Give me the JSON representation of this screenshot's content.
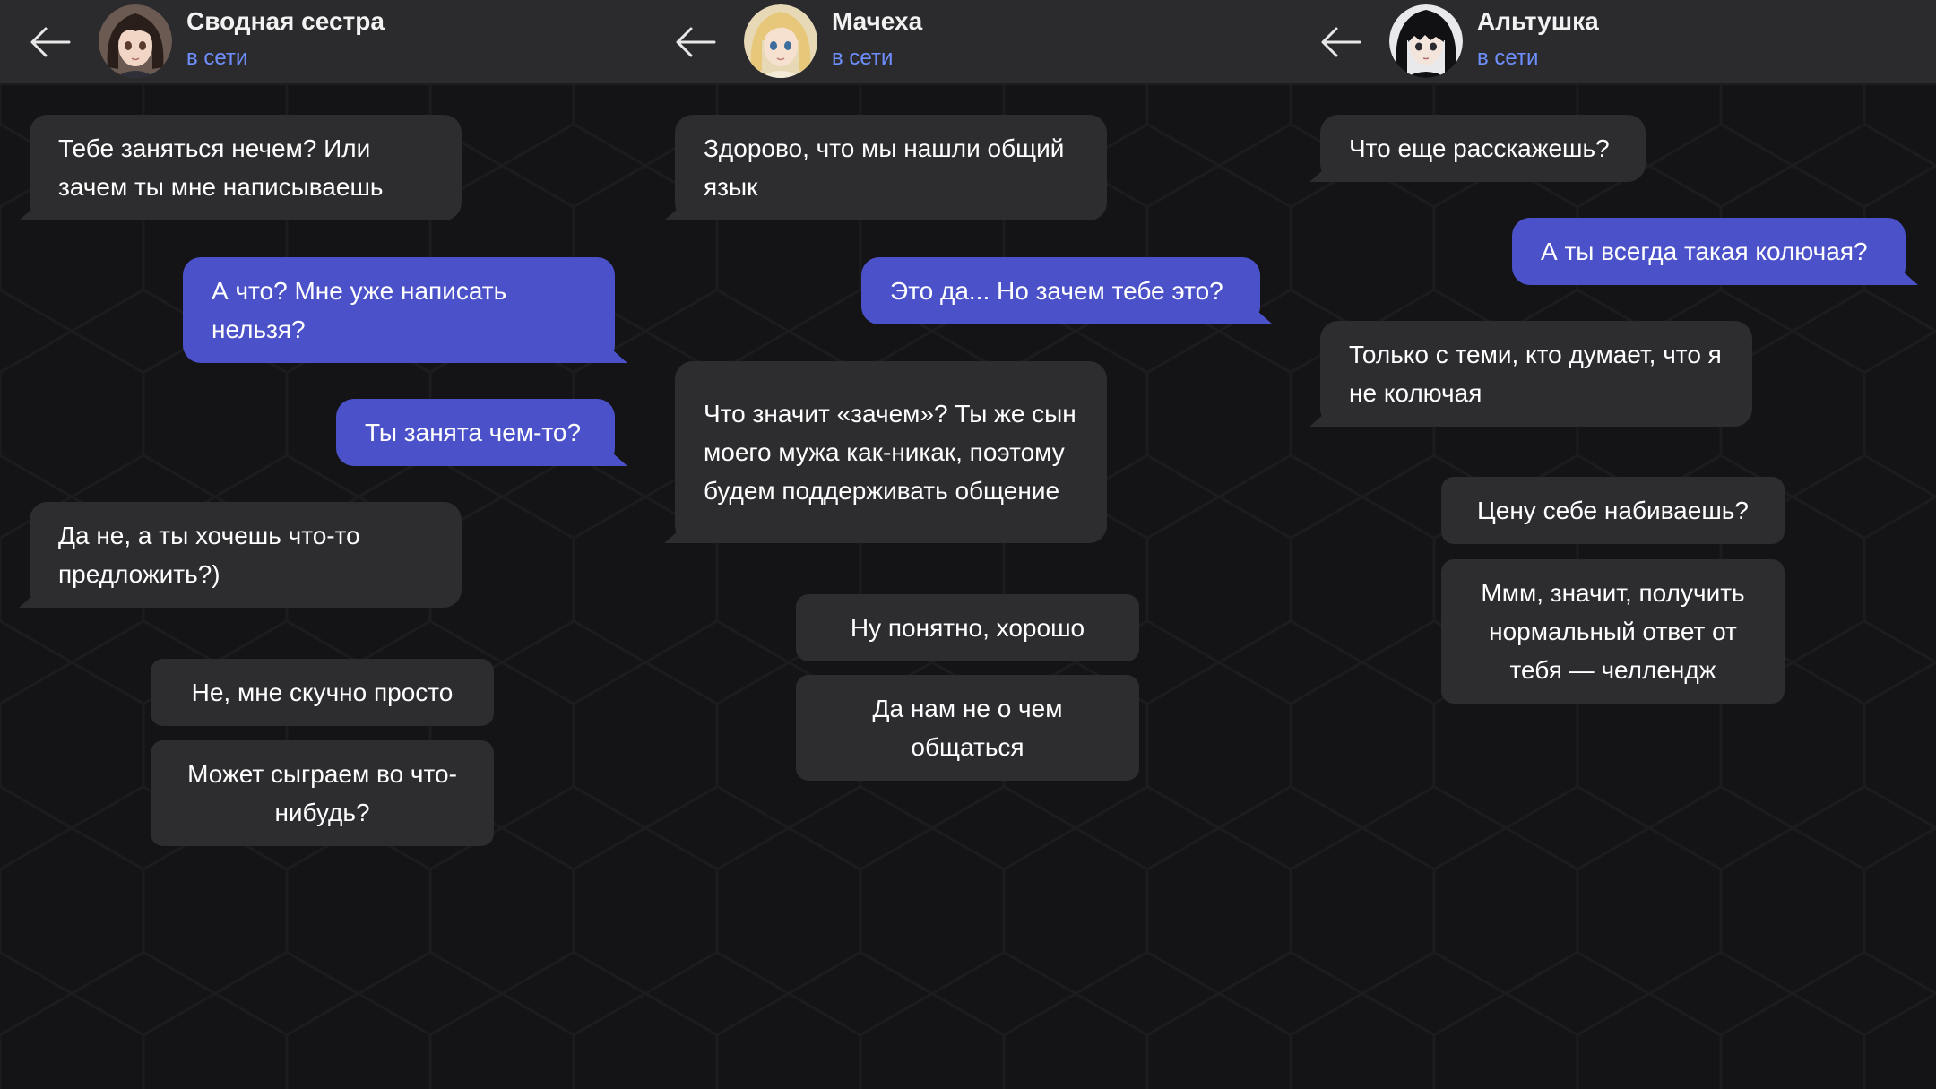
{
  "chats": [
    {
      "contact": {
        "name": "Сводная сестра",
        "status": "в сети",
        "avatar": "anime-girl-dark-hair-avatar"
      },
      "messages": [
        {
          "from": "contact",
          "text": "Тебе заняться нечем? Или зачем ты мне написываешь"
        },
        {
          "from": "user",
          "text": "А что? Мне уже написать нельзя?"
        },
        {
          "from": "user",
          "text": "Ты занята чем-то?"
        },
        {
          "from": "contact",
          "text": "Да не, а ты хочешь что-то предложить?)"
        },
        {
          "from": "reply-option",
          "text": "Не, мне скучно просто"
        },
        {
          "from": "reply-option",
          "text": "Может сыграем во что-нибудь?"
        }
      ]
    },
    {
      "contact": {
        "name": "Мачеха",
        "status": "в сети",
        "avatar": "anime-woman-blonde-avatar"
      },
      "messages": [
        {
          "from": "contact",
          "text": "Здорово, что мы нашли общий язык"
        },
        {
          "from": "user",
          "text": "Это да... Но зачем тебе это?"
        },
        {
          "from": "contact",
          "text": "Что значит «зачем»? Ты же сын моего мужа как-никак, поэтому будем поддерживать общение"
        },
        {
          "from": "reply-option",
          "text": "Ну понятно, хорошо"
        },
        {
          "from": "reply-option",
          "text": "Да нам не о чем общаться"
        }
      ]
    },
    {
      "contact": {
        "name": "Альтушка",
        "status": "в сети",
        "avatar": "anime-girl-black-hair-avatar"
      },
      "messages": [
        {
          "from": "contact",
          "text": "Что еще расскажешь?"
        },
        {
          "from": "user",
          "text": "А ты всегда такая колючая?"
        },
        {
          "from": "contact",
          "text": "Только с теми, кто думает, что я не колючая"
        },
        {
          "from": "reply-option",
          "text": "Цену себе набиваешь?"
        },
        {
          "from": "reply-option",
          "text": "Ммм, значит, получить нормальный ответ от тебя — челлендж"
        }
      ]
    }
  ],
  "colors": {
    "background": "#141416",
    "header": "#2b2b2e",
    "incoming_bubble": "#2d2d30",
    "outgoing_bubble": "#4b52c9",
    "status": "#6f8fff"
  }
}
